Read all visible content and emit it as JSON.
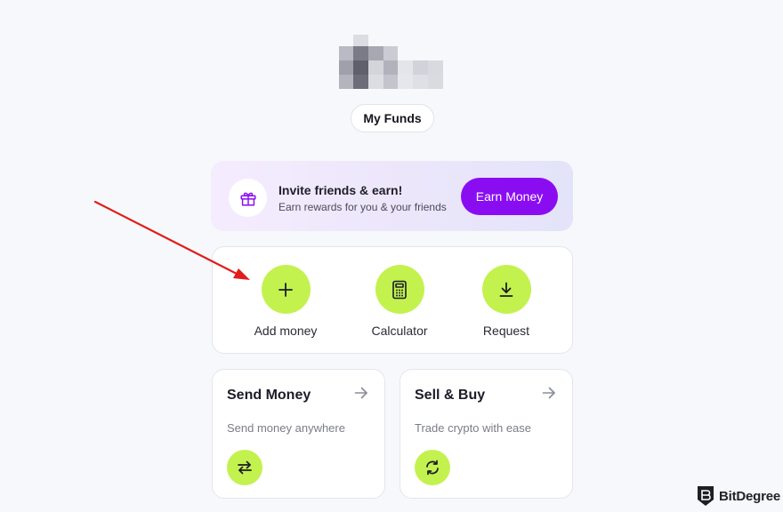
{
  "funds_button": {
    "label": "My Funds"
  },
  "invite": {
    "title": "Invite friends & earn!",
    "subtitle": "Earn rewards for you & your friends",
    "button_label": "Earn Money",
    "icon": "gift-icon"
  },
  "actions": [
    {
      "label": "Add money",
      "icon": "plus-icon"
    },
    {
      "label": "Calculator",
      "icon": "calculator-icon"
    },
    {
      "label": "Request",
      "icon": "download-icon"
    }
  ],
  "tiles": [
    {
      "title": "Send Money",
      "subtitle": "Send money anywhere",
      "icon": "swap-arrows-icon"
    },
    {
      "title": "Sell & Buy",
      "subtitle": "Trade crypto with ease",
      "icon": "refresh-icon"
    }
  ],
  "watermark": {
    "brand": "BitDegree"
  },
  "colors": {
    "accent_green": "#c3f24f",
    "accent_purple": "#8a0df2",
    "annotation_red": "#e01c1c"
  }
}
